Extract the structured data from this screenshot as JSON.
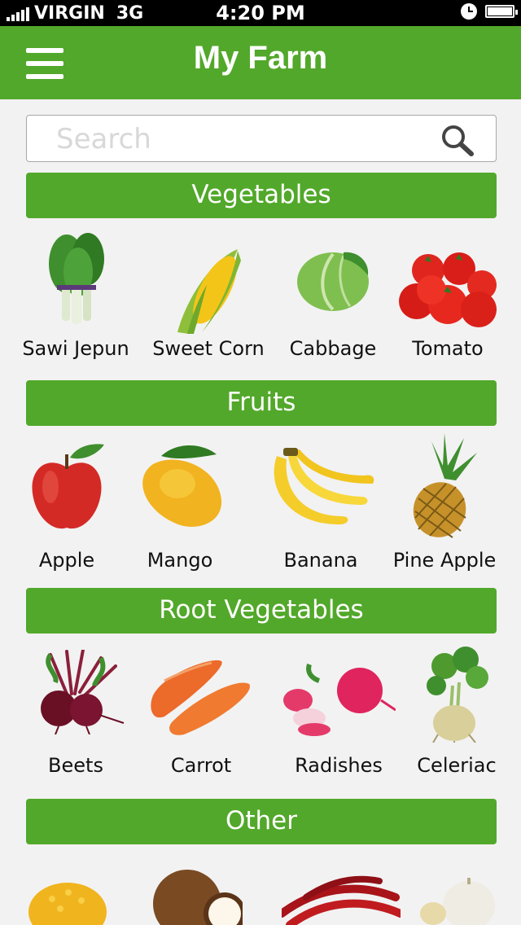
{
  "status": {
    "carrier": "VIRGIN",
    "network": "3G",
    "time": "4:20 PM"
  },
  "header": {
    "title": "My Farm"
  },
  "search": {
    "placeholder": "Search"
  },
  "sections": [
    {
      "title": "Vegetables",
      "items": [
        "Sawi Jepun",
        "Sweet Corn",
        "Cabbage",
        "Tomato"
      ]
    },
    {
      "title": "Fruits",
      "items": [
        "Apple",
        "Mango",
        "Banana",
        "Pine Apple"
      ]
    },
    {
      "title": "Root Vegetables",
      "items": [
        "Beets",
        "Carrot",
        "Radishes",
        "Celeriac"
      ]
    },
    {
      "title": "Other",
      "items": [
        "",
        "",
        "",
        ""
      ]
    }
  ],
  "colors": {
    "brand_green": "#52a82a",
    "background": "#f2f2f2"
  }
}
